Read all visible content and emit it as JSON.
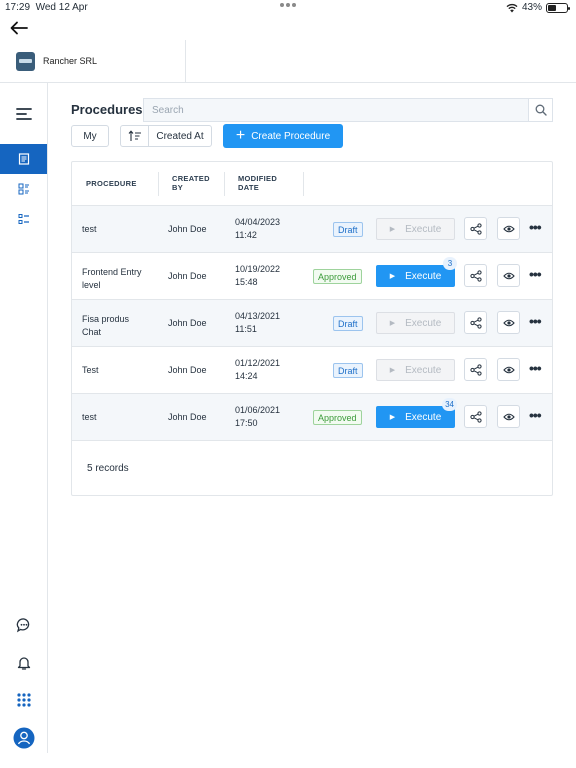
{
  "status_bar": {
    "time": "17:29",
    "date": "Wed 12 Apr",
    "battery": "43%",
    "battery_level": 0.43
  },
  "company": {
    "name": "Rancher SRL"
  },
  "page": {
    "title": "Procedures",
    "search_placeholder": "Search",
    "my_label": "My",
    "sort_label": "Created At",
    "create_label": "Create Procedure"
  },
  "table": {
    "headers": {
      "procedure": "PROCEDURE",
      "created_by_1": "CREATED",
      "created_by_2": "BY",
      "modified_1": "MODIFIED",
      "modified_2": "DATE"
    },
    "rows": [
      {
        "name_1": "test",
        "name_2": "",
        "created_by": "John Doe",
        "date": "04/04/2023",
        "time": "11:42",
        "status": "Draft",
        "execute": "Execute",
        "count": ""
      },
      {
        "name_1": "Frontend Entry",
        "name_2": "level",
        "created_by": "John Doe",
        "date": "10/19/2022",
        "time": "15:48",
        "status": "Approved",
        "execute": "Execute",
        "count": "3"
      },
      {
        "name_1": "Fisa produs",
        "name_2": "Chat",
        "created_by": "John Doe",
        "date": "04/13/2021",
        "time": "11:51",
        "status": "Draft",
        "execute": "Execute",
        "count": ""
      },
      {
        "name_1": "Test",
        "name_2": "",
        "created_by": "John Doe",
        "date": "01/12/2021",
        "time": "14:24",
        "status": "Draft",
        "execute": "Execute",
        "count": ""
      },
      {
        "name_1": "test",
        "name_2": "",
        "created_by": "John Doe",
        "date": "01/06/2021",
        "time": "17:50",
        "status": "Approved",
        "execute": "Execute",
        "count": "34"
      }
    ],
    "records_label": "5 records"
  },
  "colors": {
    "primary": "#2196f3",
    "sidebar_active": "#1565c0",
    "draft": "#1e6fc8",
    "approved": "#3b9b39"
  },
  "icons": {
    "back": "arrow-left-icon",
    "menu": "hamburger-icon",
    "procedures": "document-icon",
    "dashboard": "grid-list-icon",
    "checklist": "checklist-icon",
    "chat": "chat-icon",
    "bell": "bell-icon",
    "apps": "apps-grid-icon",
    "user": "user-icon",
    "search": "search-icon",
    "sort": "sort-icon",
    "share": "share-icon",
    "view": "eye-icon",
    "more": "more-icon"
  }
}
